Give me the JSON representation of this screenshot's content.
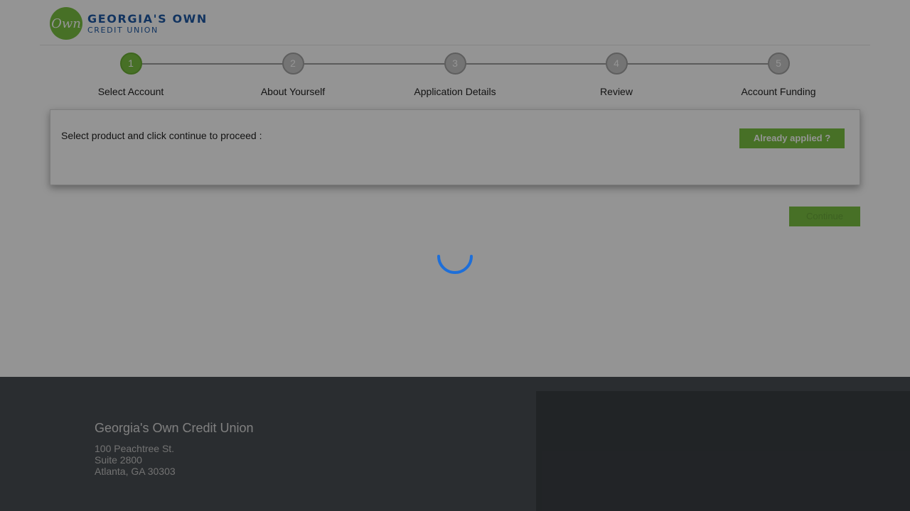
{
  "brand": {
    "logo_mark": "Own",
    "name_line1": "GEORGIA'S OWN",
    "name_line2": "CREDIT UNION",
    "color_primary": "#7ac142",
    "color_text": "#1f5aa6"
  },
  "stepper": {
    "steps": [
      {
        "number": "1",
        "label": "Select Account",
        "active": true
      },
      {
        "number": "2",
        "label": "About Yourself",
        "active": false
      },
      {
        "number": "3",
        "label": "Application Details",
        "active": false
      },
      {
        "number": "4",
        "label": "Review",
        "active": false
      },
      {
        "number": "5",
        "label": "Account Funding",
        "active": false
      }
    ]
  },
  "panel": {
    "instruction": "Select product and click continue to proceed :",
    "already_applied_label": "Already applied ?"
  },
  "actions": {
    "continue_label": "Continue"
  },
  "footer": {
    "title": "Georgia's Own Credit Union",
    "address_line1": "100 Peachtree St.",
    "address_line2": "Suite 2800",
    "address_line3": "Atlanta, GA 30303"
  },
  "loading": {
    "visible": true,
    "spinner_color": "#1e6fd9",
    "overlay_color": "rgba(0,0,0,0.42)"
  }
}
